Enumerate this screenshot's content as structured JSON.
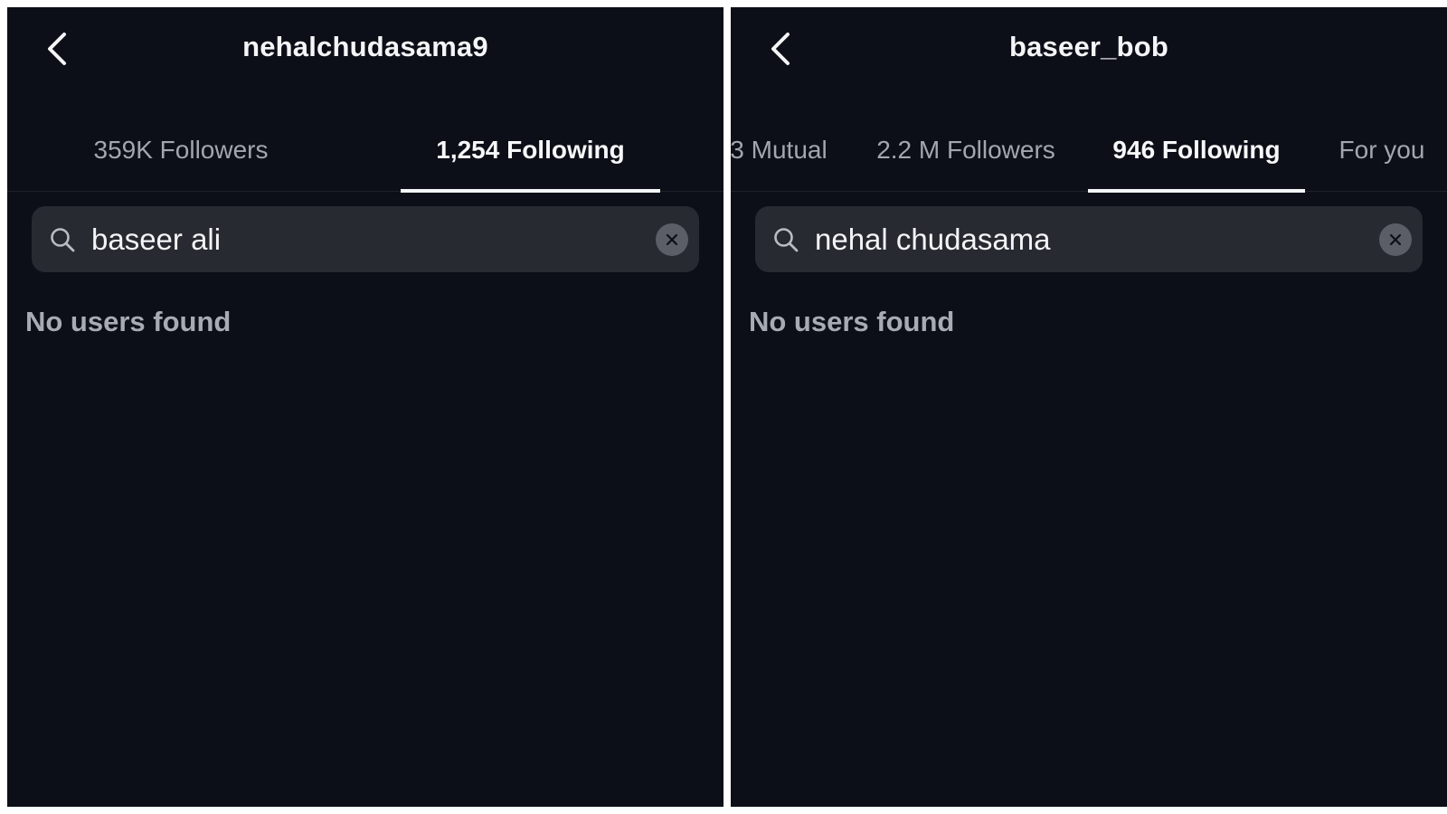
{
  "colors": {
    "panel_bg": "#0c0f17",
    "search_bg": "#272a31",
    "active_text": "#f6f7f9",
    "inactive_text": "#a2a6ae"
  },
  "panels": [
    {
      "title": "nehalchudasama9",
      "back_icon": "chevron-left-icon",
      "tabs": [
        {
          "label": "359K Followers",
          "active": false
        },
        {
          "label": "1,254 Following",
          "active": true
        }
      ],
      "search": {
        "value": "baseer ali",
        "icon": "search-icon",
        "clear_icon": "close-icon"
      },
      "empty_message": "No users found"
    },
    {
      "title": "baseer_bob",
      "back_icon": "chevron-left-icon",
      "tabs": [
        {
          "label": "3 Mutual",
          "active": false
        },
        {
          "label": "2.2 M Followers",
          "active": false
        },
        {
          "label": "946 Following",
          "active": true
        },
        {
          "label": "For you",
          "active": false
        }
      ],
      "search": {
        "value": "nehal chudasama",
        "icon": "search-icon",
        "clear_icon": "close-icon"
      },
      "empty_message": "No users found"
    }
  ]
}
